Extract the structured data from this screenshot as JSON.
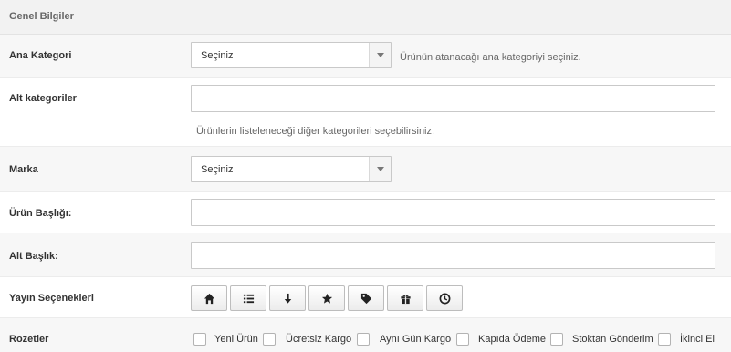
{
  "panel": {
    "title": "Genel Bilgiler"
  },
  "ana_kategori": {
    "label": "Ana Kategori",
    "selected": "Seçiniz",
    "hint": "Ürünün atanacağı ana kategoriyi seçiniz."
  },
  "alt_kategoriler": {
    "label": "Alt kategoriler",
    "value": "",
    "hint": "Ürünlerin listeleneceği diğer kategorileri seçebilirsiniz."
  },
  "marka": {
    "label": "Marka",
    "selected": "Seçiniz"
  },
  "urun_basligi": {
    "label": "Ürün Başlığı:",
    "value": ""
  },
  "alt_baslik": {
    "label": "Alt Başlık:",
    "value": ""
  },
  "yayin": {
    "label": "Yayın Seçenekleri",
    "buttons": [
      "home-icon",
      "list-icon",
      "arrow-down-icon",
      "star-icon",
      "tag-icon",
      "gift-icon",
      "clock-icon"
    ]
  },
  "rozetler": {
    "label": "Rozetler",
    "options": [
      {
        "label": "Yeni Ürün",
        "checked": false
      },
      {
        "label": "Ücretsiz Kargo",
        "checked": false
      },
      {
        "label": "Aynı Gün Kargo",
        "checked": false
      },
      {
        "label": "Kapıda Ödeme",
        "checked": false
      },
      {
        "label": "Stoktan Gönderim",
        "checked": false
      },
      {
        "label": "İkinci El",
        "checked": false
      }
    ]
  }
}
